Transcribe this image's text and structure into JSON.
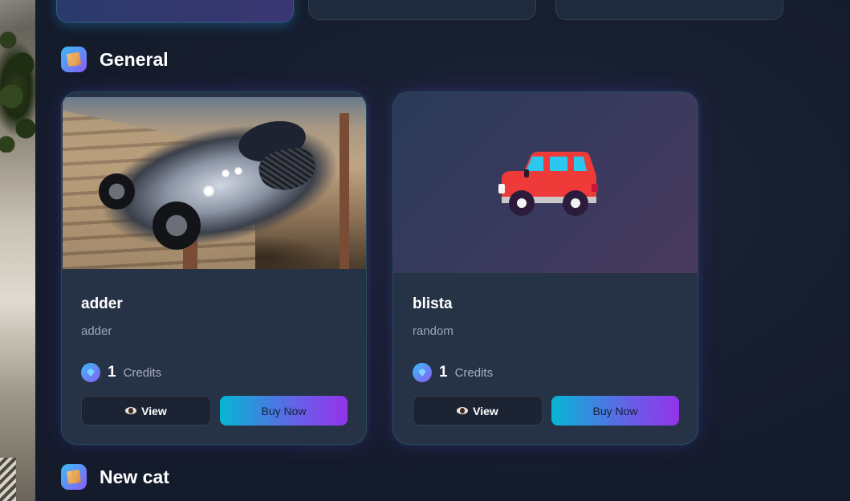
{
  "sections": [
    {
      "title": "General",
      "icon": "box-icon",
      "items": [
        {
          "name": "adder",
          "subtitle": "adder",
          "image": "car-photo",
          "price": "1",
          "price_unit": "Credits",
          "view_label": "View",
          "buy_label": "Buy Now"
        },
        {
          "name": "blista",
          "subtitle": "random",
          "image": "car-icon",
          "price": "1",
          "price_unit": "Credits",
          "view_label": "View",
          "buy_label": "Buy Now"
        }
      ]
    },
    {
      "title": "New cat",
      "icon": "box-icon",
      "items": []
    }
  ],
  "colors": {
    "background": "#141b2b",
    "card": "#263246",
    "card_border": "#2b4a5e",
    "accent_start": "#06b6d4",
    "accent_end": "#9333ea",
    "muted_text": "#9aa6b8"
  }
}
